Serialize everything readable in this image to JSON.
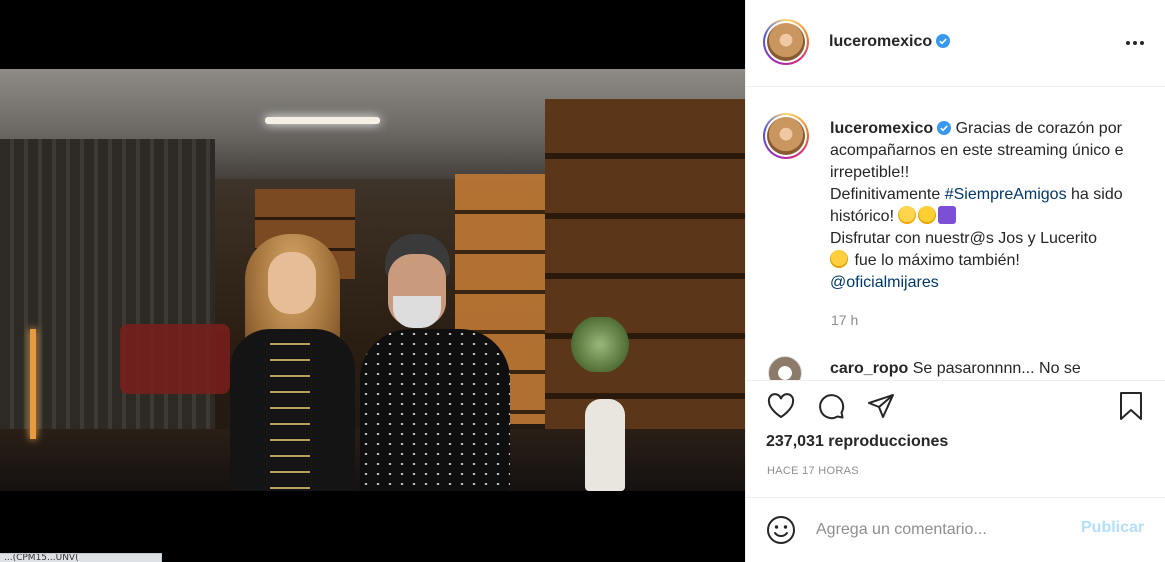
{
  "post": {
    "username": "luceromexico",
    "verified": true,
    "caption_user": "luceromexico",
    "caption_line1": "Gracias de corazón por acompañarnos en este streaming único e irrepetible!!",
    "caption_line2_pre": "Definitivamente",
    "hashtag": "#SiempreAmigos",
    "caption_line2_post": "ha sido histórico!",
    "caption_line3": "Disfrutar con nuestr@s Jos y Lucerito",
    "caption_line4": "fue lo máximo también!",
    "mention": "@oficialmijares",
    "timestamp": "17 h",
    "views": "237,031 reproducciones",
    "posted_ago": "HACE 17 HORAS"
  },
  "comments": [
    {
      "user": "caro_ropo",
      "text": "Se pasaronnnn... No se"
    }
  ],
  "comment_input": {
    "placeholder": "Agrega un comentario...",
    "publish_label": "Publicar"
  },
  "status_bar": {
    "url": "...(CPM15...UNV("
  },
  "icons": [
    "more-icon",
    "verified-badge-icon",
    "like-icon",
    "comment-icon",
    "share-icon",
    "save-icon",
    "emoji-icon",
    "mute-icon"
  ],
  "colors": {
    "link": "#00376b",
    "publish_disabled": "#b2dffc",
    "secondary_text": "#8e8e8e",
    "verified": "#3897f0"
  }
}
